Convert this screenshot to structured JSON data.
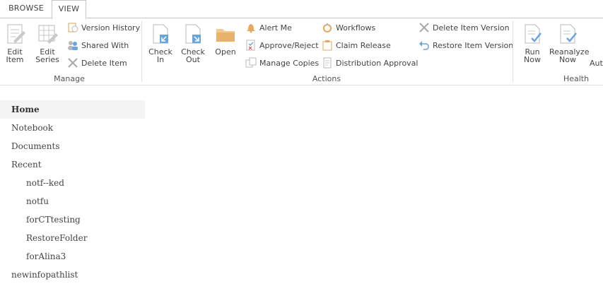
{
  "tabs": [
    {
      "label": "BROWSE",
      "active": false
    },
    {
      "label": "VIEW",
      "active": true
    }
  ],
  "ribbon": {
    "manage": {
      "label": "Manage",
      "edit_item": "Edit Item",
      "edit_series": "Edit Series",
      "version_history": "Version History",
      "shared_with": "Shared With",
      "delete_item": "Delete Item"
    },
    "actions": {
      "label": "Actions",
      "check_in": "Check In",
      "check_out": "Check Out",
      "open": "Open",
      "alert_me": "Alert Me",
      "approve_reject": "Approve/Reject",
      "manage_copies": "Manage Copies",
      "workflows": "Workflows",
      "claim_release": "Claim Release",
      "distribution_approval": "Distribution Approval",
      "delete_item_version": "Delete Item Version",
      "restore_item_version": "Restore Item Version"
    },
    "health": {
      "label": "Health",
      "run_now": "Run Now",
      "reanalyze_now": "Reanalyze Now",
      "auto": "Auto"
    }
  },
  "nav": {
    "items": [
      {
        "label": "Home",
        "selected": true,
        "level": 0
      },
      {
        "label": "Notebook",
        "level": 0
      },
      {
        "label": "Documents",
        "level": 0
      },
      {
        "label": "Recent",
        "level": 0
      },
      {
        "label": "notf--ked",
        "level": 1
      },
      {
        "label": "notfu",
        "level": 1
      },
      {
        "label": "forCTtesting",
        "level": 1
      },
      {
        "label": "RestoreFolder",
        "level": 1
      },
      {
        "label": "forAlina3",
        "level": 1
      },
      {
        "label": "newinfopathlist",
        "level": 0
      }
    ]
  },
  "colors": {
    "icon_gray": "#b8b8b8",
    "icon_blue": "#6aa5d9",
    "icon_orange": "#e8a75a",
    "selected_bg": "#f4f4f4"
  }
}
